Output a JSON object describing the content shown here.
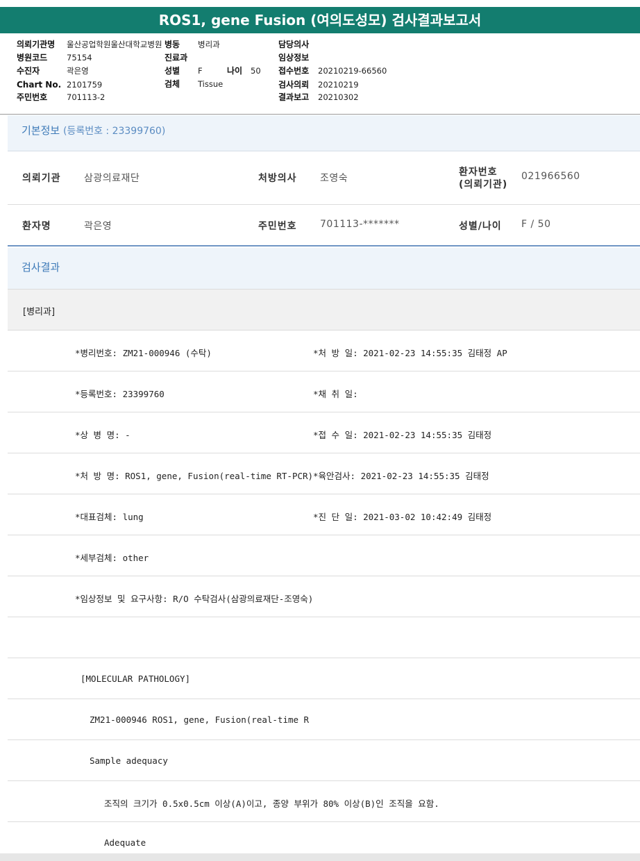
{
  "title": "ROS1, gene Fusion (여의도성모) 검사결과보고서",
  "summary": {
    "inst_label": "의뢰기관명",
    "inst_value": "울산공업학원울산대학교병원",
    "ward_label": "병동",
    "ward_value": "병리과",
    "doctor_label": "담당의사",
    "doctor_value": "",
    "hosp_code_label": "병원코드",
    "hosp_code_value": "75154",
    "dept_label": "진료과",
    "dept_value": "",
    "clinical_label": "임상정보",
    "clinical_value": "",
    "patient_label": "수진자",
    "patient_value": "곽은영",
    "sex_label": "성별",
    "sex_value": "F",
    "age_label": "나이",
    "age_value": "50",
    "receipt_label": "접수번호",
    "receipt_value": "20210219-66560",
    "chart_label": "Chart No.",
    "chart_value": "2101759",
    "specimen_label": "검체",
    "specimen_value": "Tissue",
    "request_label": "검사의뢰",
    "request_value": "20210219",
    "rrn_label": "주민번호",
    "rrn_value": "701113-2",
    "report_label": "결과보고",
    "report_value": "20210302"
  },
  "basic_info": {
    "heading": "기본정보",
    "reg_text": "(등록번호 : 23399760)",
    "inst_label": "의뢰기관",
    "inst_value": "삼광의료재단",
    "prescriber_label": "처방의사",
    "prescriber_value": "조영숙",
    "patient_no_label_1": "환자번호",
    "patient_no_label_2": "(의뢰기관)",
    "patient_no_value": "021966560",
    "name_label": "환자명",
    "name_value": "곽은영",
    "rrn_label": "주민번호",
    "rrn_value": "701113-*******",
    "sex_age_label": "성별/나이",
    "sex_age_value": "F / 50"
  },
  "results": {
    "heading": "검사결과",
    "dept": "[병리과]",
    "rows": [
      {
        "left": "*병리번호: ZM21-000946 (수탁)",
        "right": "*처 방 일: 2021-02-23 14:55:35  김태정 AP"
      },
      {
        "left": "*등록번호: 23399760",
        "right": "*채 취 일:"
      },
      {
        "left": "*상 병 명: -",
        "right": "*접 수 일: 2021-02-23 14:55:35  김태정"
      },
      {
        "left": "*처 방 명: ROS1, gene, Fusion(real-time RT-PCR)",
        "right": "*육안검사: 2021-02-23 14:55:35  김태정"
      },
      {
        "left": "*대표검체: lung",
        "right": "*진 단 일: 2021-03-02 10:42:49  김태정"
      },
      {
        "left": "*세부검체: other",
        "right": ""
      },
      {
        "left": "*임상정보 및 요구사항: R/O 수탁검사(삼광의료재단-조영숙)",
        "right": ""
      }
    ],
    "lines": [
      {
        "text": "",
        "indent": 0
      },
      {
        "text": "[MOLECULAR PATHOLOGY]",
        "indent": 105
      },
      {
        "text": "ZM21-000946     ROS1, gene, Fusion(real-time R",
        "indent": 118
      },
      {
        "text": "Sample adequacy",
        "indent": 118
      },
      {
        "text": "조직의 크기가 0.5x0.5cm 이상(A)이고, 종양 부위가 80% 이상(B)인 조직을 요함.",
        "indent": 139
      },
      {
        "text": "Adequate",
        "indent": 139
      }
    ]
  }
}
